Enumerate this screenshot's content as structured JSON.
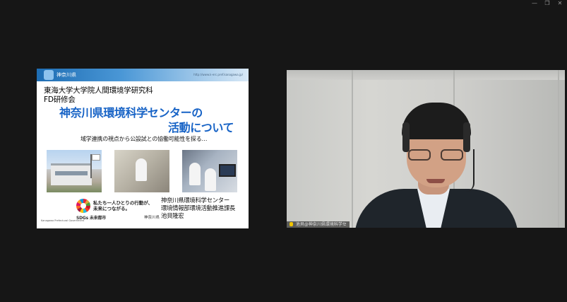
{
  "window": {
    "controls": [
      "—",
      "❐",
      "✕"
    ]
  },
  "share": {
    "header": {
      "prefecture": "神奈川県",
      "url": "http://www.k-erc.pref.kanagawa.jp/"
    },
    "line1": "東海大学大学院人間環境学研究科",
    "line2": "FD研修会",
    "title_line1": "神奈川県環境科学センターの",
    "title_line2": "活動について",
    "subtitle": "域学連携の視点から公設試との協働可能性を探る…",
    "sdg": {
      "slogan_line1": "私たち一人ひとりの行動が、",
      "slogan_line2": "未来につながる。",
      "label": "SDGs 未来都市",
      "pref_mark": "神奈川県",
      "gov": "Kanagawa Prefectural Government"
    },
    "presenter": {
      "org": "神奈川県環境科学センター",
      "title": "環境情報部環境活動推進課長",
      "name": "池貝隆宏"
    }
  },
  "cam": {
    "participant_name": "池貝@神奈川県環境科学セ"
  },
  "colors": {
    "accent_title": "#1763c6",
    "background": "#161616"
  }
}
